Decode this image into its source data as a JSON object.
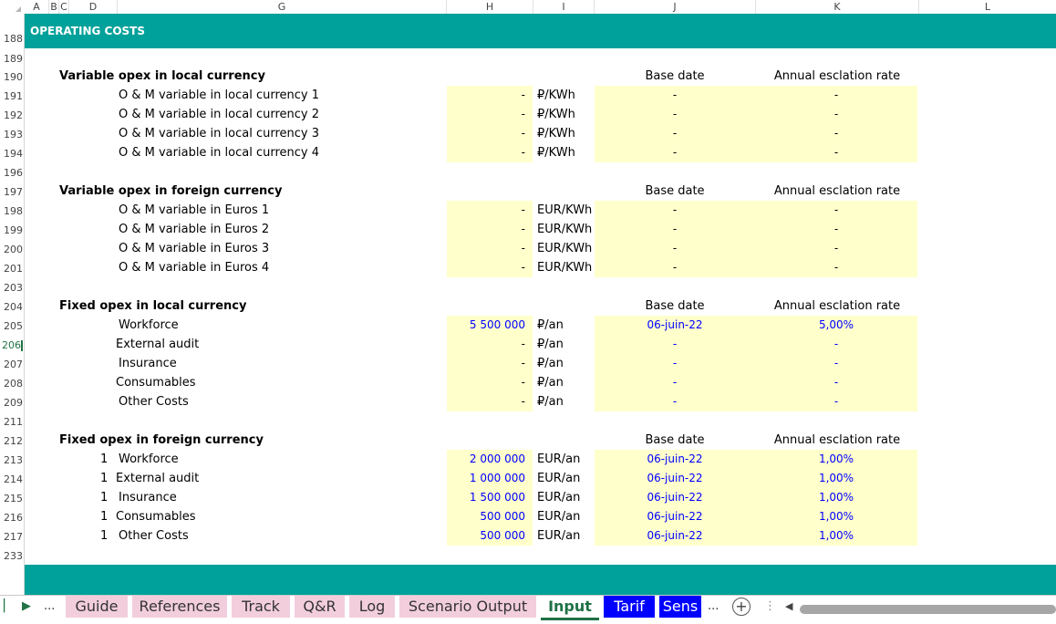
{
  "columns": [
    "A",
    "B",
    "C",
    "D",
    "G",
    "H",
    "I",
    "J",
    "K",
    "L"
  ],
  "header_band": {
    "title": "OPERATING COSTS"
  },
  "row_numbers": [
    "188",
    "189",
    "190",
    "191",
    "192",
    "193",
    "194",
    "196",
    "197",
    "198",
    "199",
    "200",
    "201",
    "203",
    "204",
    "205",
    "206",
    "207",
    "208",
    "209",
    "211",
    "212",
    "213",
    "214",
    "215",
    "216",
    "217",
    "233"
  ],
  "sections": {
    "var_local": {
      "title": "Variable opex in local currency",
      "base_date_label": "Base date",
      "rate_label": "Annual esclation rate",
      "rows": [
        {
          "label": "O & M variable in local currency 1",
          "value": "-",
          "unit": "₽/KWh",
          "date": "-",
          "rate": "-"
        },
        {
          "label": "O & M variable in local currency 2",
          "value": "-",
          "unit": "₽/KWh",
          "date": "-",
          "rate": "-"
        },
        {
          "label": "O & M variable in local currency 3",
          "value": "-",
          "unit": "₽/KWh",
          "date": "-",
          "rate": "-"
        },
        {
          "label": "O & M variable in local currency 4",
          "value": "-",
          "unit": "₽/KWh",
          "date": "-",
          "rate": "-"
        }
      ]
    },
    "var_foreign": {
      "title": "Variable opex in foreign currency",
      "base_date_label": "Base date",
      "rate_label": "Annual esclation rate",
      "rows": [
        {
          "label": "O & M variable in Euros 1",
          "value": "-",
          "unit": "EUR/KWh",
          "date": "-",
          "rate": "-"
        },
        {
          "label": "O & M variable in Euros 2",
          "value": "-",
          "unit": "EUR/KWh",
          "date": "-",
          "rate": "-"
        },
        {
          "label": "O & M variable in Euros 3",
          "value": "-",
          "unit": "EUR/KWh",
          "date": "-",
          "rate": "-"
        },
        {
          "label": "O & M variable in Euros 4",
          "value": "-",
          "unit": "EUR/KWh",
          "date": "-",
          "rate": "-"
        }
      ]
    },
    "fixed_local": {
      "title": "Fixed opex in local currency",
      "base_date_label": "Base date",
      "rate_label": "Annual esclation rate",
      "rows": [
        {
          "label": "Workforce",
          "value": "5 500 000",
          "unit": "₽/an",
          "date": "06-juin-22",
          "rate": "5,00%"
        },
        {
          "label": "External audit",
          "value": "-",
          "unit": "₽/an",
          "date": "-",
          "rate": "-"
        },
        {
          "label": "Insurance",
          "value": "-",
          "unit": "₽/an",
          "date": "-",
          "rate": "-"
        },
        {
          "label": "Consumables",
          "value": "-",
          "unit": "₽/an",
          "date": "-",
          "rate": "-"
        },
        {
          "label": "Other Costs",
          "value": "-",
          "unit": "₽/an",
          "date": "-",
          "rate": "-"
        }
      ]
    },
    "fixed_foreign": {
      "title": "Fixed opex in foreign currency",
      "base_date_label": "Base date",
      "rate_label": "Annual esclation rate",
      "rows": [
        {
          "flag": "1",
          "label": "Workforce",
          "value": "2 000 000",
          "unit": "EUR/an",
          "date": "06-juin-22",
          "rate": "1,00%"
        },
        {
          "flag": "1",
          "label": "External audit",
          "value": "1 000 000",
          "unit": "EUR/an",
          "date": "06-juin-22",
          "rate": "1,00%"
        },
        {
          "flag": "1",
          "label": "Insurance",
          "value": "1 500 000",
          "unit": "EUR/an",
          "date": "06-juin-22",
          "rate": "1,00%"
        },
        {
          "flag": "1",
          "label": "Consumables",
          "value": "500 000",
          "unit": "EUR/an",
          "date": "06-juin-22",
          "rate": "1,00%"
        },
        {
          "flag": "1",
          "label": "Other Costs",
          "value": "500 000",
          "unit": "EUR/an",
          "date": "06-juin-22",
          "rate": "1,00%"
        }
      ]
    }
  },
  "sheet_tabs": {
    "ellipsis": "...",
    "tabs": [
      "Guide",
      "References",
      "Track",
      "Q&R",
      "Log",
      "Scenario Output",
      "Input",
      "Tarif",
      "Sens"
    ],
    "active": "Input",
    "more": "...",
    "add": "+"
  }
}
